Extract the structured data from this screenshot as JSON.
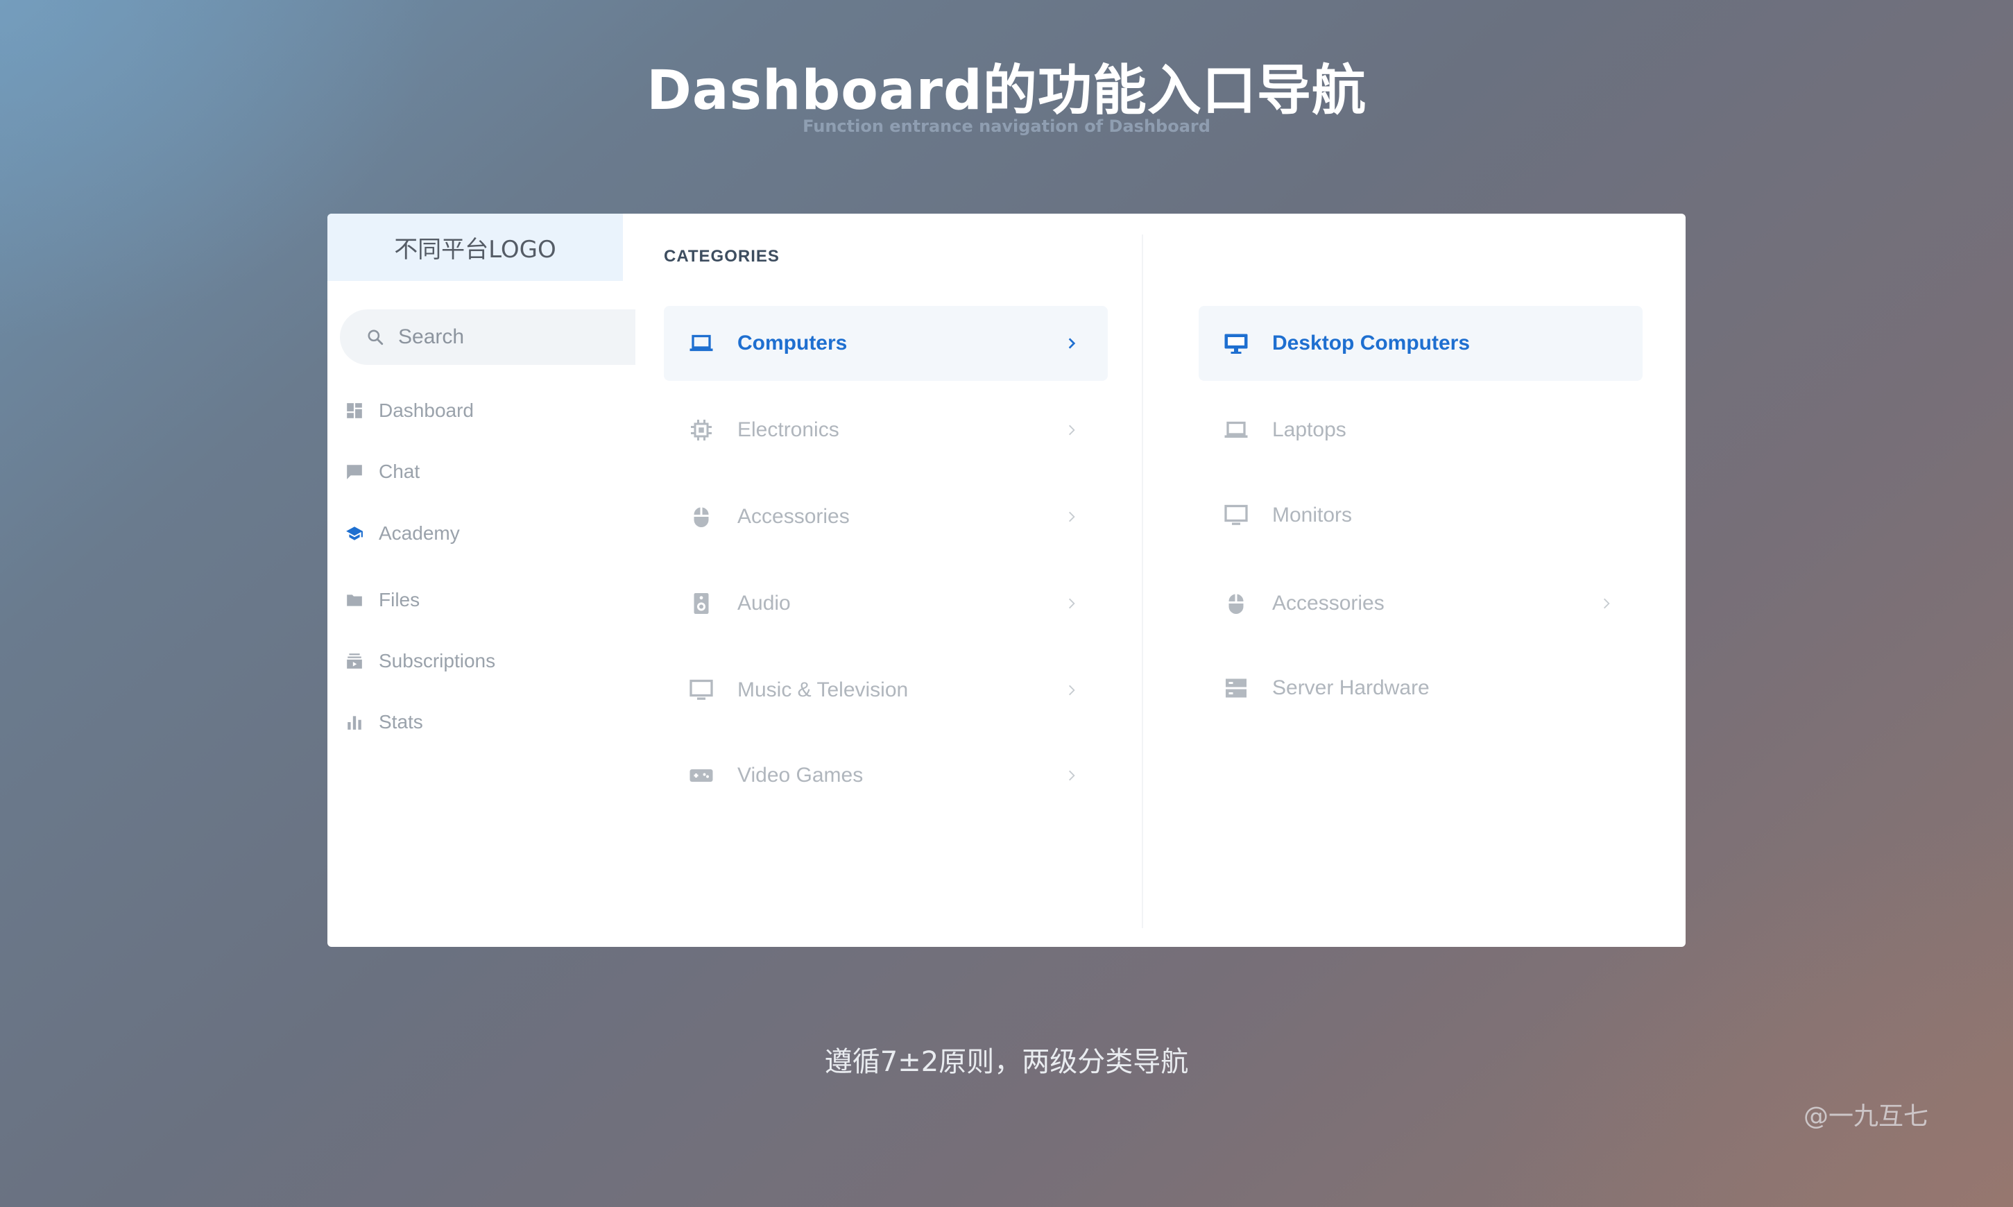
{
  "page": {
    "title": "Dashboard的功能入口导航",
    "subtitle": "Function entrance navigation of Dashboard",
    "caption": "遵循7±2原则，两级分类导航",
    "watermark": "@一九互七"
  },
  "colors": {
    "accent": "#1e6fd0",
    "muted_text": "#b0b6bd",
    "sidebar_text": "#9aa2ab",
    "active_row_bg": "#f3f7fb",
    "logo_bg": "#eaf3fc"
  },
  "sidebar": {
    "logo": "不同平台LOGO",
    "search_placeholder": "Search",
    "items": [
      {
        "label": "Dashboard",
        "icon": "dashboard-icon",
        "active": false
      },
      {
        "label": "Chat",
        "icon": "chat-icon",
        "active": false
      },
      {
        "label": "Academy",
        "icon": "school-icon",
        "active": true
      },
      {
        "label": "Files",
        "icon": "folder-icon",
        "active": false
      },
      {
        "label": "Subscriptions",
        "icon": "subscriptions-icon",
        "active": false
      },
      {
        "label": "Stats",
        "icon": "bar-chart-icon",
        "active": false
      }
    ]
  },
  "categories": {
    "heading": "CATEGORIES",
    "items": [
      {
        "label": "Computers",
        "icon": "laptop-icon",
        "active": true,
        "has_children": true
      },
      {
        "label": "Electronics",
        "icon": "chip-icon",
        "active": false,
        "has_children": true
      },
      {
        "label": "Accessories",
        "icon": "mouse-icon",
        "active": false,
        "has_children": true
      },
      {
        "label": "Audio",
        "icon": "speaker-icon",
        "active": false,
        "has_children": true
      },
      {
        "label": "Music & Television",
        "icon": "tv-icon",
        "active": false,
        "has_children": true
      },
      {
        "label": "Video Games",
        "icon": "gamepad-icon",
        "active": false,
        "has_children": true
      }
    ]
  },
  "subcategories": {
    "items": [
      {
        "label": "Desktop Computers",
        "icon": "desktop-icon",
        "active": true,
        "has_children": false
      },
      {
        "label": "Laptops",
        "icon": "laptop-icon",
        "active": false,
        "has_children": false
      },
      {
        "label": "Monitors",
        "icon": "monitor-icon",
        "active": false,
        "has_children": false
      },
      {
        "label": "Accessories",
        "icon": "mouse-icon",
        "active": false,
        "has_children": true
      },
      {
        "label": "Server Hardware",
        "icon": "server-icon",
        "active": false,
        "has_children": false
      }
    ]
  }
}
